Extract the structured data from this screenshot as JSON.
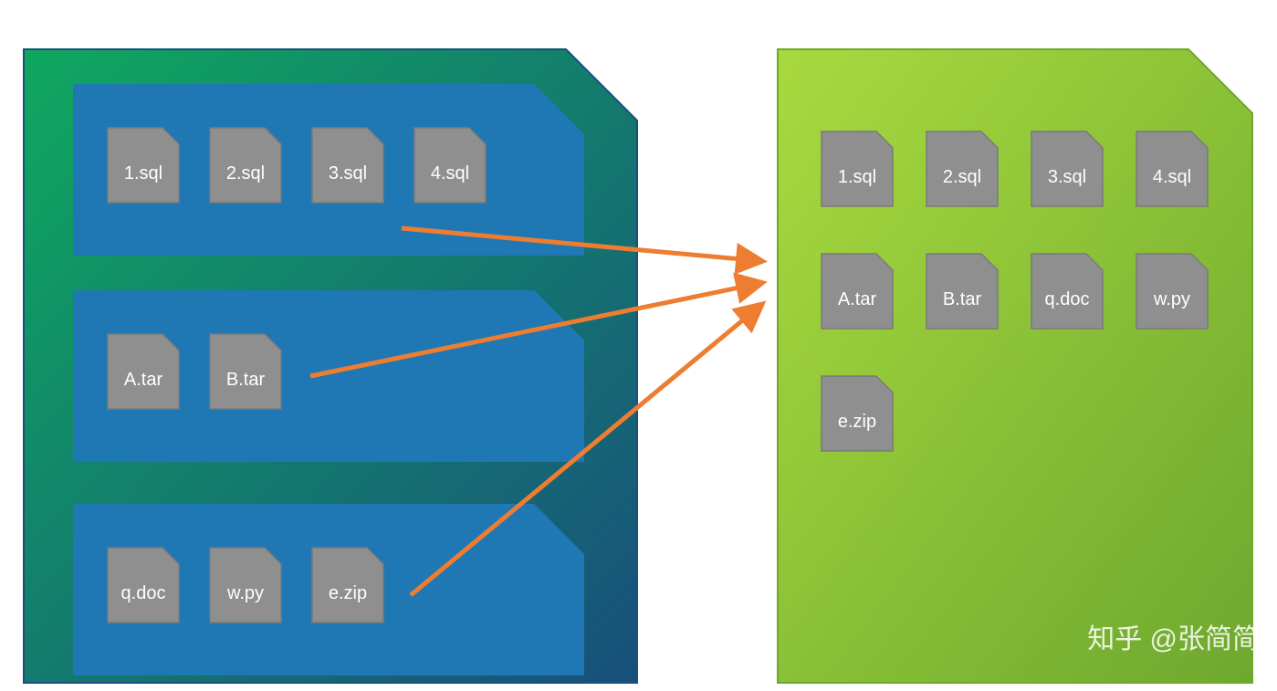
{
  "leftContainer": {
    "groups": [
      {
        "files": [
          "1.sql",
          "2.sql",
          "3.sql",
          "4.sql"
        ]
      },
      {
        "files": [
          "A.tar",
          "B.tar"
        ]
      },
      {
        "files": [
          "q.doc",
          "w.py",
          "e.zip"
        ]
      }
    ]
  },
  "rightContainer": {
    "rows": [
      [
        "1.sql",
        "2.sql",
        "3.sql",
        "4.sql"
      ],
      [
        "A.tar",
        "B.tar",
        "q.doc",
        "w.py"
      ],
      [
        "e.zip"
      ]
    ]
  },
  "watermark": "知乎 @张简简",
  "colors": {
    "leftGradStart": "#0fa85f",
    "leftGradEnd": "#184f7c",
    "groupFill": "#1f78b4",
    "rightGradStart": "#a8da3f",
    "rightGradEnd": "#6ea82e",
    "fileFill": "#8f8f8f",
    "fileStroke": "#7a7a7a",
    "arrow": "#ed7d31"
  }
}
